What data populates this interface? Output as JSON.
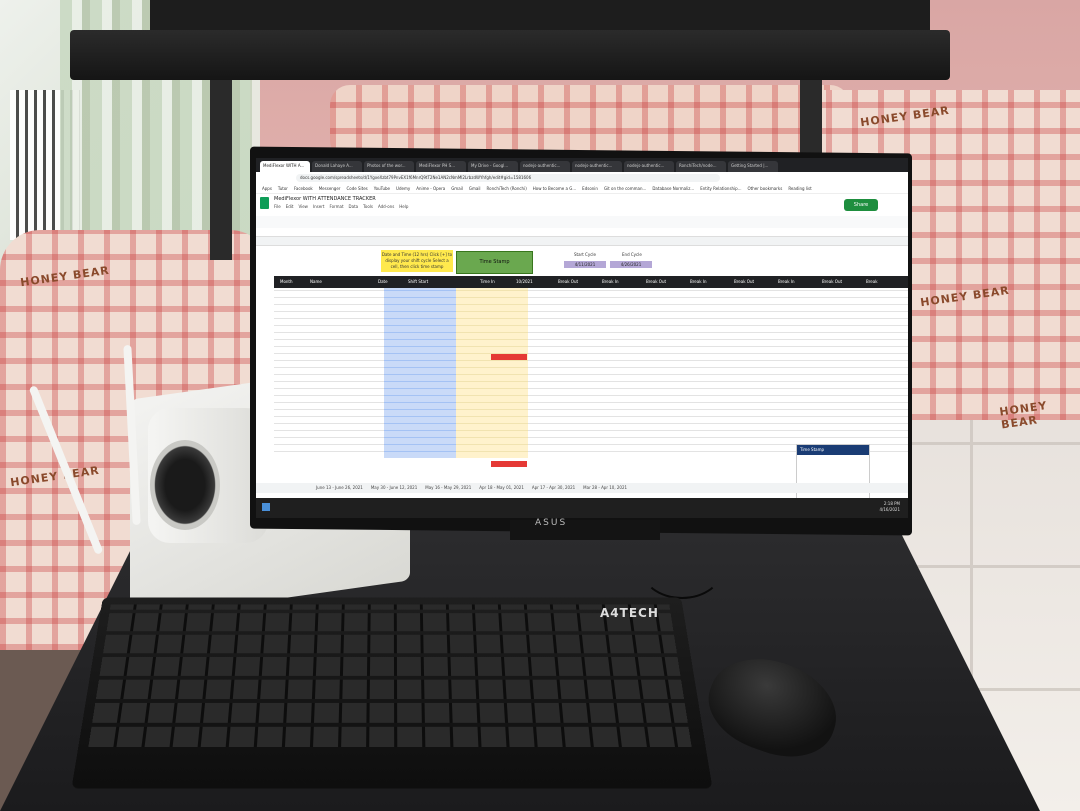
{
  "scene": {
    "sofa_print": [
      "HONEY BEAR",
      "HONEY BEAR",
      "HONEY BEAR",
      "HONEY BEAR",
      "HONEY BEAR"
    ],
    "monitor_brand": "ASUS",
    "keyboard_brand": "A4TECH"
  },
  "browser": {
    "tabs": [
      "MediFlexor WITH A...",
      "Donald Lahaye A...",
      "Photos of the wor...",
      "MediFlexor PH S...",
      "My Drive - Googl...",
      "nodejs-authentic...",
      "nodejs-authentic...",
      "nodejs-authentic...",
      "RonchiTech/node...",
      "Getting Started |..."
    ],
    "url": "docs.google.com/spreadsheets/d/1YgxeXzbt79PnvEX1f6MnrQ9tT2Ne1AN2cNmMl2LrbzdWYhfgh/edit#gid=1581606",
    "bookmarks": [
      "Apps",
      "Tutor",
      "Facebook",
      "Messenger",
      "Code Sites",
      "YouTube",
      "Udemy",
      "Anime - Opera",
      "Gmail",
      "Gmail",
      "RonchiTech (Ronchi)",
      "How to Become a G...",
      "Edsonin",
      "Git on the comman...",
      "Database Normaliz...",
      "Entity Relationship...",
      "Other bookmarks",
      "Reading list"
    ]
  },
  "sheet": {
    "title": "MediFlexor WITH ATTENDANCE TRACKER",
    "menus": [
      "File",
      "Edit",
      "View",
      "Insert",
      "Format",
      "Data",
      "Tools",
      "Add-ons",
      "Help"
    ],
    "share_label": "Share",
    "yellow_note": "Date and Time (12 hrs) Click [+] to display your shift cycle Select a cell, then click time stamp",
    "timestamp_button": "Time Stamp",
    "start_cycle_label": "Start Cycle",
    "end_cycle_label": "End Cycle",
    "start_cycle_value": "4/11/2021",
    "end_cycle_value": "4/26/2021",
    "headers": [
      "Month",
      "Name",
      "Date",
      "Shift Start",
      "Time In",
      "10/2021",
      "Break Out",
      "Break In",
      "Break Out",
      "Break In",
      "Break Out",
      "Break In",
      "Break Out",
      "Break"
    ],
    "sheet_tabs": [
      "June 13 - June 26, 2021",
      "May 30 - June 12, 2021",
      "May 16 - May 29, 2021",
      "Apr 18 - May 01, 2021",
      "Apr 17 - Apr 30, 2021",
      "Mar 28 - Apr 10, 2021"
    ],
    "mini_panel_title": "Time Stamp"
  },
  "taskbar": {
    "time": "2:18 PM",
    "date": "4/16/2021"
  }
}
